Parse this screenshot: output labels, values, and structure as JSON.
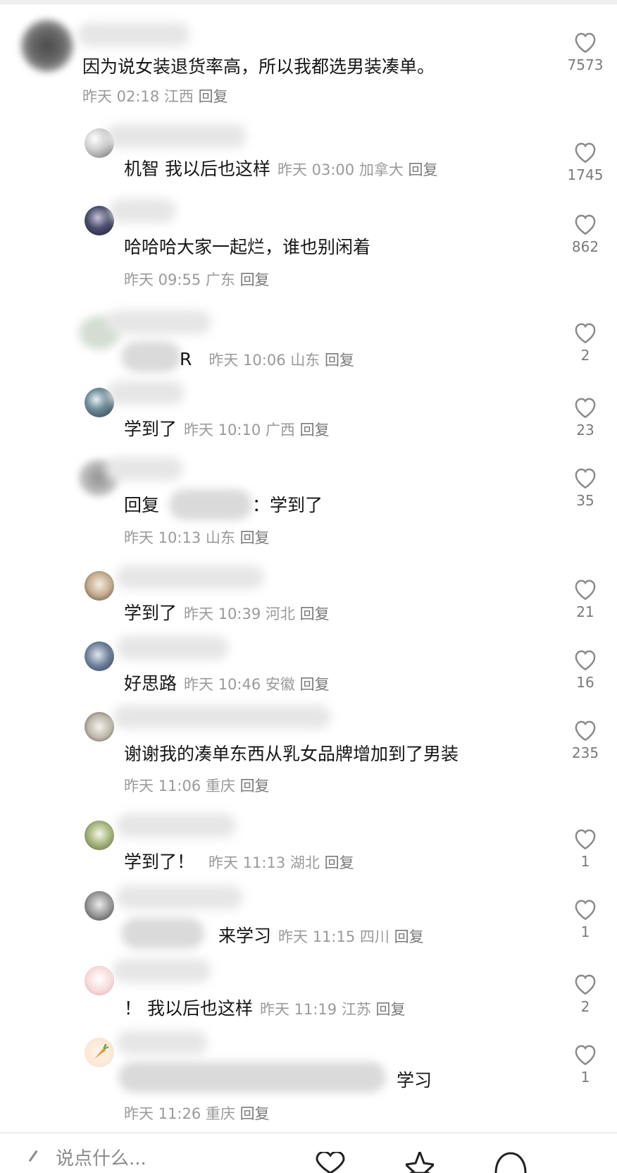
{
  "comments": [
    {
      "text": "因为说女装退货率高，所以我都选男装凑单。",
      "meta": "昨天 02:18 江西",
      "reply": "回复",
      "likes": "7573"
    },
    {
      "text": "机智 我以后也这样",
      "meta": "昨天 03:00 加拿大",
      "reply": "回复",
      "likes": "1745"
    },
    {
      "text": "哈哈哈大家一起烂，谁也别闲着",
      "meta": "昨天 09:55 广东",
      "reply": "回复",
      "likes": "862"
    },
    {
      "text": "R",
      "meta": "昨天 10:06 山东",
      "reply": "回复",
      "likes": "2"
    },
    {
      "text": "学到了",
      "meta": "昨天 10:10 广西",
      "reply": "回复",
      "likes": "23"
    },
    {
      "text_prefix": "回复",
      "text": "：学到了",
      "meta": "昨天 10:13 山东",
      "reply": "回复",
      "likes": "35"
    },
    {
      "text": "学到了",
      "meta": "昨天 10:39 河北",
      "reply": "回复",
      "likes": "21"
    },
    {
      "text": "好思路",
      "meta": "昨天 10:46 安徽",
      "reply": "回复",
      "likes": "16"
    },
    {
      "text": "谢谢我的凑单东西从乳女品牌增加到了男装",
      "meta": "昨天 11:06 重庆",
      "reply": "回复",
      "likes": "235"
    },
    {
      "text": "学到了！",
      "meta": "昨天 11:13 湖北",
      "reply": "回复",
      "likes": "1"
    },
    {
      "text": "来学习",
      "meta": "昨天 11:15 四川",
      "reply": "回复",
      "likes": "1"
    },
    {
      "text": "！ 我以后也这样",
      "meta": "昨天 11:19 江苏",
      "reply": "回复",
      "likes": "2"
    },
    {
      "text": "学习",
      "meta": "昨天 11:26 重庆",
      "reply": "回复",
      "likes": "1"
    }
  ],
  "bottom_bar": {
    "input_placeholder": "说点什么..."
  },
  "colors": {
    "text": "#161616",
    "meta": "#9a9a9a",
    "icon": "#8a8a8a"
  }
}
